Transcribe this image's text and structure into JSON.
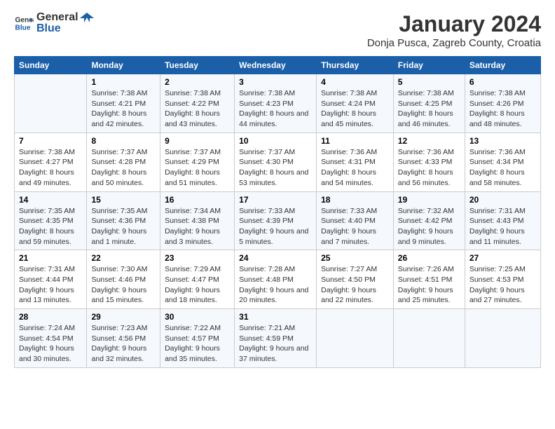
{
  "logo": {
    "line1": "General",
    "line2": "Blue"
  },
  "title": "January 2024",
  "subtitle": "Donja Pusca, Zagreb County, Croatia",
  "days_header": [
    "Sunday",
    "Monday",
    "Tuesday",
    "Wednesday",
    "Thursday",
    "Friday",
    "Saturday"
  ],
  "weeks": [
    [
      {
        "day": "",
        "sunrise": "",
        "sunset": "",
        "daylight": ""
      },
      {
        "day": "1",
        "sunrise": "Sunrise: 7:38 AM",
        "sunset": "Sunset: 4:21 PM",
        "daylight": "Daylight: 8 hours and 42 minutes."
      },
      {
        "day": "2",
        "sunrise": "Sunrise: 7:38 AM",
        "sunset": "Sunset: 4:22 PM",
        "daylight": "Daylight: 8 hours and 43 minutes."
      },
      {
        "day": "3",
        "sunrise": "Sunrise: 7:38 AM",
        "sunset": "Sunset: 4:23 PM",
        "daylight": "Daylight: 8 hours and 44 minutes."
      },
      {
        "day": "4",
        "sunrise": "Sunrise: 7:38 AM",
        "sunset": "Sunset: 4:24 PM",
        "daylight": "Daylight: 8 hours and 45 minutes."
      },
      {
        "day": "5",
        "sunrise": "Sunrise: 7:38 AM",
        "sunset": "Sunset: 4:25 PM",
        "daylight": "Daylight: 8 hours and 46 minutes."
      },
      {
        "day": "6",
        "sunrise": "Sunrise: 7:38 AM",
        "sunset": "Sunset: 4:26 PM",
        "daylight": "Daylight: 8 hours and 48 minutes."
      }
    ],
    [
      {
        "day": "7",
        "sunrise": "Sunrise: 7:38 AM",
        "sunset": "Sunset: 4:27 PM",
        "daylight": "Daylight: 8 hours and 49 minutes."
      },
      {
        "day": "8",
        "sunrise": "Sunrise: 7:37 AM",
        "sunset": "Sunset: 4:28 PM",
        "daylight": "Daylight: 8 hours and 50 minutes."
      },
      {
        "day": "9",
        "sunrise": "Sunrise: 7:37 AM",
        "sunset": "Sunset: 4:29 PM",
        "daylight": "Daylight: 8 hours and 51 minutes."
      },
      {
        "day": "10",
        "sunrise": "Sunrise: 7:37 AM",
        "sunset": "Sunset: 4:30 PM",
        "daylight": "Daylight: 8 hours and 53 minutes."
      },
      {
        "day": "11",
        "sunrise": "Sunrise: 7:36 AM",
        "sunset": "Sunset: 4:31 PM",
        "daylight": "Daylight: 8 hours and 54 minutes."
      },
      {
        "day": "12",
        "sunrise": "Sunrise: 7:36 AM",
        "sunset": "Sunset: 4:33 PM",
        "daylight": "Daylight: 8 hours and 56 minutes."
      },
      {
        "day": "13",
        "sunrise": "Sunrise: 7:36 AM",
        "sunset": "Sunset: 4:34 PM",
        "daylight": "Daylight: 8 hours and 58 minutes."
      }
    ],
    [
      {
        "day": "14",
        "sunrise": "Sunrise: 7:35 AM",
        "sunset": "Sunset: 4:35 PM",
        "daylight": "Daylight: 8 hours and 59 minutes."
      },
      {
        "day": "15",
        "sunrise": "Sunrise: 7:35 AM",
        "sunset": "Sunset: 4:36 PM",
        "daylight": "Daylight: 9 hours and 1 minute."
      },
      {
        "day": "16",
        "sunrise": "Sunrise: 7:34 AM",
        "sunset": "Sunset: 4:38 PM",
        "daylight": "Daylight: 9 hours and 3 minutes."
      },
      {
        "day": "17",
        "sunrise": "Sunrise: 7:33 AM",
        "sunset": "Sunset: 4:39 PM",
        "daylight": "Daylight: 9 hours and 5 minutes."
      },
      {
        "day": "18",
        "sunrise": "Sunrise: 7:33 AM",
        "sunset": "Sunset: 4:40 PM",
        "daylight": "Daylight: 9 hours and 7 minutes."
      },
      {
        "day": "19",
        "sunrise": "Sunrise: 7:32 AM",
        "sunset": "Sunset: 4:42 PM",
        "daylight": "Daylight: 9 hours and 9 minutes."
      },
      {
        "day": "20",
        "sunrise": "Sunrise: 7:31 AM",
        "sunset": "Sunset: 4:43 PM",
        "daylight": "Daylight: 9 hours and 11 minutes."
      }
    ],
    [
      {
        "day": "21",
        "sunrise": "Sunrise: 7:31 AM",
        "sunset": "Sunset: 4:44 PM",
        "daylight": "Daylight: 9 hours and 13 minutes."
      },
      {
        "day": "22",
        "sunrise": "Sunrise: 7:30 AM",
        "sunset": "Sunset: 4:46 PM",
        "daylight": "Daylight: 9 hours and 15 minutes."
      },
      {
        "day": "23",
        "sunrise": "Sunrise: 7:29 AM",
        "sunset": "Sunset: 4:47 PM",
        "daylight": "Daylight: 9 hours and 18 minutes."
      },
      {
        "day": "24",
        "sunrise": "Sunrise: 7:28 AM",
        "sunset": "Sunset: 4:48 PM",
        "daylight": "Daylight: 9 hours and 20 minutes."
      },
      {
        "day": "25",
        "sunrise": "Sunrise: 7:27 AM",
        "sunset": "Sunset: 4:50 PM",
        "daylight": "Daylight: 9 hours and 22 minutes."
      },
      {
        "day": "26",
        "sunrise": "Sunrise: 7:26 AM",
        "sunset": "Sunset: 4:51 PM",
        "daylight": "Daylight: 9 hours and 25 minutes."
      },
      {
        "day": "27",
        "sunrise": "Sunrise: 7:25 AM",
        "sunset": "Sunset: 4:53 PM",
        "daylight": "Daylight: 9 hours and 27 minutes."
      }
    ],
    [
      {
        "day": "28",
        "sunrise": "Sunrise: 7:24 AM",
        "sunset": "Sunset: 4:54 PM",
        "daylight": "Daylight: 9 hours and 30 minutes."
      },
      {
        "day": "29",
        "sunrise": "Sunrise: 7:23 AM",
        "sunset": "Sunset: 4:56 PM",
        "daylight": "Daylight: 9 hours and 32 minutes."
      },
      {
        "day": "30",
        "sunrise": "Sunrise: 7:22 AM",
        "sunset": "Sunset: 4:57 PM",
        "daylight": "Daylight: 9 hours and 35 minutes."
      },
      {
        "day": "31",
        "sunrise": "Sunrise: 7:21 AM",
        "sunset": "Sunset: 4:59 PM",
        "daylight": "Daylight: 9 hours and 37 minutes."
      },
      {
        "day": "",
        "sunrise": "",
        "sunset": "",
        "daylight": ""
      },
      {
        "day": "",
        "sunrise": "",
        "sunset": "",
        "daylight": ""
      },
      {
        "day": "",
        "sunrise": "",
        "sunset": "",
        "daylight": ""
      }
    ]
  ]
}
